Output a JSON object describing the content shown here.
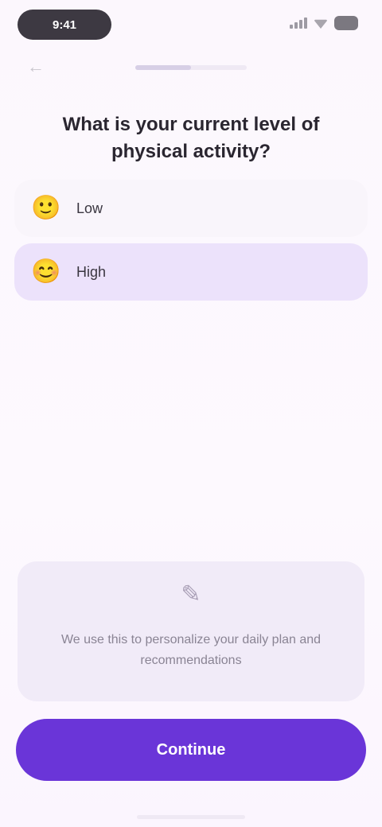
{
  "status_bar": {
    "time": "9:41"
  },
  "progress": {
    "fraction": 0.5
  },
  "question": {
    "title": "What is your current level of physical activity?"
  },
  "options": [
    {
      "emoji": "🙂",
      "label": "Low",
      "selected": false
    },
    {
      "emoji": "😊",
      "label": "High",
      "selected": true
    }
  ],
  "info_card": {
    "icon": "lightbulb-icon",
    "text": "We use this to personalize your daily plan and recommendations"
  },
  "continue_button": {
    "label": "Continue"
  },
  "colors": {
    "accent": "#6a35d8",
    "selected_option": "#ece2fb",
    "background": "#fdf8fe"
  }
}
